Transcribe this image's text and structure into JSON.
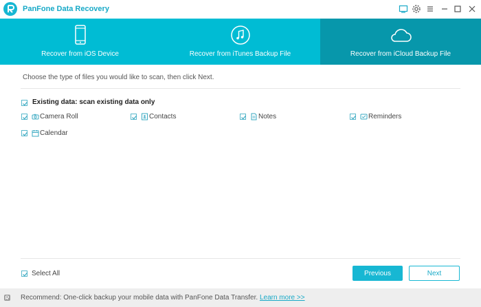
{
  "window": {
    "title": "PanFone Data Recovery",
    "controls": [
      "screen-icon",
      "gear-icon",
      "menu-icon",
      "minimize-icon",
      "maximize-icon",
      "close-icon"
    ]
  },
  "tabs": [
    {
      "label": "Recover from iOS Device",
      "icon": "phone-icon",
      "active": false
    },
    {
      "label": "Recover from iTunes Backup File",
      "icon": "music-icon",
      "active": false
    },
    {
      "label": "Recover from iCloud Backup File",
      "icon": "cloud-icon",
      "active": true
    }
  ],
  "content": {
    "instruction": "Choose the type of files you would like to scan, then click Next.",
    "existing_data_label": "Existing data: scan existing data only",
    "file_types": [
      {
        "label": "Camera Roll",
        "icon": "camera-icon",
        "checked": true
      },
      {
        "label": "Contacts",
        "icon": "contacts-icon",
        "checked": true
      },
      {
        "label": "Notes",
        "icon": "notes-icon",
        "checked": true
      },
      {
        "label": "Reminders",
        "icon": "reminders-icon",
        "checked": true
      },
      {
        "label": "Calendar",
        "icon": "calendar-icon",
        "checked": true
      }
    ]
  },
  "bottom": {
    "select_all_label": "Select All",
    "select_all_checked": true,
    "previous_label": "Previous",
    "next_label": "Next"
  },
  "footer": {
    "text": "Recommend: One-click backup your mobile data with PanFone Data Transfer. ",
    "link": "Learn more >>"
  },
  "colors": {
    "accent": "#17b7d3",
    "tab_bg": "#00bcd4",
    "tab_active_bg": "#0797ab",
    "footer_bg": "#eeeeee"
  }
}
